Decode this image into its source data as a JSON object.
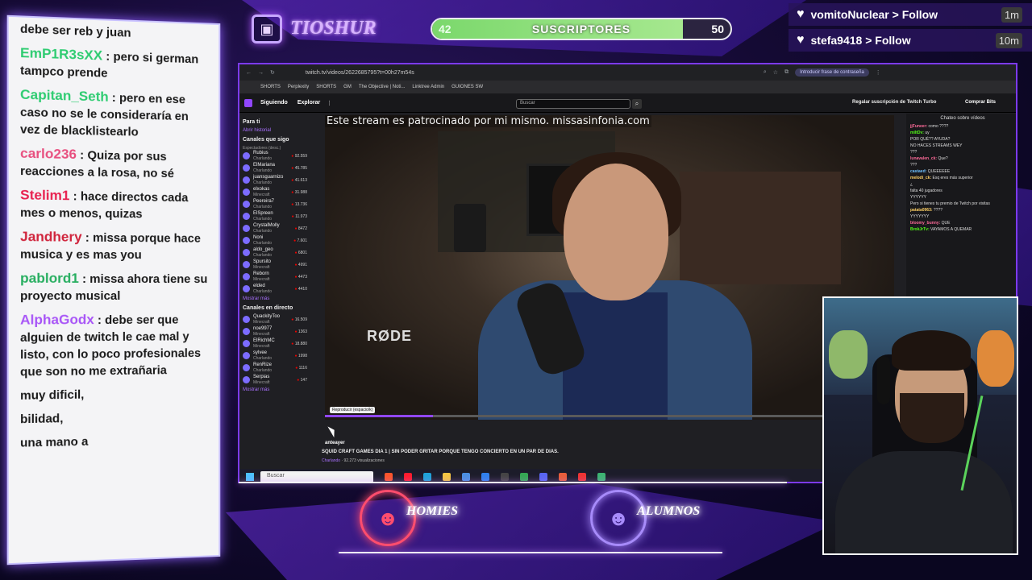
{
  "overlay": {
    "logo_text": "TIOSHUR",
    "subs": {
      "title": "SUSCRIPTORES",
      "current": "42",
      "goal": "50",
      "progress_fraction": 0.84
    },
    "follows": [
      {
        "user": "vomitoNuclear",
        "action": "Follow",
        "time": "1m"
      },
      {
        "user": "stefa9418",
        "action": "Follow",
        "time": "10m"
      }
    ],
    "chat": [
      {
        "user": "",
        "color": "#1a1a1a",
        "text": "debe ser reb y juan"
      },
      {
        "user": "EmP1R3sXX",
        "color": "#2ecc71",
        "text": "pero si german tampco prende"
      },
      {
        "user": "Capitan_Seth",
        "color": "#2ecc71",
        "text": "pero en ese caso no se le consideraría en vez de blacklistearlo"
      },
      {
        "user": "carlo236",
        "color": "#e84f7f",
        "text": "Quiza por sus reacciones a la rosa, no sé"
      },
      {
        "user": "Stelim1",
        "color": "#e8204f",
        "text": "hace directos cada mes o menos, quizas"
      },
      {
        "user": "Jandhery",
        "color": "#d0243c",
        "text": "missa porque hace musica y es mas you"
      },
      {
        "user": "pablord1",
        "color": "#27ae60",
        "text": "missa ahora tiene su proyecto musical"
      },
      {
        "user": "AlphaGodx",
        "color": "#a855f7",
        "text": "debe ser que alguien de twitch le cae mal y listo, con lo poco profesionales que son no me extrañaria"
      },
      {
        "user": "",
        "color": "#1a1a1a",
        "text": "muy dificil,"
      },
      {
        "user": "",
        "color": "#1a1a1a",
        "text": "bilidad,"
      },
      {
        "user": "",
        "color": "#1a1a1a",
        "text": "una mano a"
      }
    ],
    "bottom_logos": [
      "HOMIES",
      "ALUMNOS"
    ]
  },
  "browser": {
    "url": "twitch.tv/videos/2622685795?t=00h27m54s",
    "password_prompt": "Introducir frase de contraseña",
    "bookmarks": [
      "SHORTS",
      "Perplexity",
      "SHORTS",
      "GM",
      "The Objective | Noti...",
      "Linktree Admin",
      "GUIONES SW"
    ],
    "twitch": {
      "following": "Siguiendo",
      "explore": "Explorar",
      "search_placeholder": "Buscar",
      "gift": "Regalar suscripción de Twitch Turbo",
      "bits": "Comprar Bits",
      "for_you": "Para ti",
      "history": "Abrir historial",
      "followed_heading": "Canales que sigo",
      "followed_sub": "Espectadores (desc.)",
      "followed": [
        {
          "name": "Rubius",
          "category": "Charlando",
          "viewers": "92.559"
        },
        {
          "name": "ElMariana",
          "category": "Charlando",
          "viewers": "45.785"
        },
        {
          "name": "juansguarnizo",
          "category": "Charlando",
          "viewers": "41.613"
        },
        {
          "name": "elxokas",
          "category": "Minecraft",
          "viewers": "31.988"
        },
        {
          "name": "Peereira7",
          "category": "Charlando",
          "viewers": "13.736"
        },
        {
          "name": "ElSpreen",
          "category": "Charlando",
          "viewers": "11.973"
        },
        {
          "name": "CrystalMolly",
          "category": "Charlando",
          "viewers": "8472"
        },
        {
          "name": "Noni",
          "category": "Charlando",
          "viewers": "7.601"
        },
        {
          "name": "aldo_geo",
          "category": "Charlando",
          "viewers": "6801"
        },
        {
          "name": "Spursito",
          "category": "Minecraft",
          "viewers": "4991"
        },
        {
          "name": "Reborn",
          "category": "Minecraft",
          "viewers": "4473"
        },
        {
          "name": "elded",
          "category": "Charlando",
          "viewers": "4410"
        }
      ],
      "show_more": "Mostrar más",
      "live_heading": "Canales en directo",
      "live": [
        {
          "name": "QuackityToo",
          "category": "Minecraft",
          "viewers": "16.509"
        },
        {
          "name": "noe9977",
          "category": "Minecraft",
          "viewers": "1363"
        },
        {
          "name": "ElRichMC",
          "category": "Minecraft",
          "viewers": "18.880"
        },
        {
          "name": "sylvee",
          "category": "Charlando",
          "viewers": "1998"
        },
        {
          "name": "RenRize",
          "category": "Charlando",
          "viewers": "1116"
        },
        {
          "name": "Serpias",
          "category": "Minecraft",
          "viewers": "147"
        }
      ],
      "video_overlay": "Este stream es patrocinado por mi mismo.",
      "video_overlay_url": "missasinfonia.com",
      "watermark": "RØDE",
      "tooltip": "Reproducir (espacio/k)",
      "playback_fraction": 0.19,
      "streamer": "anteayer",
      "title": "SQUID CRAFT GAMES DIA 1 | SIN PODER GRITAR PORQUE TENGO CONCIERTO EN UN PAR DE DIAS.",
      "category": "Charlando",
      "views": "92.273 visualizaciones",
      "chat_title": "Chateo sobre vídeos",
      "chat_lines": [
        {
          "user": "jjFuneer:",
          "text": "como ????"
        },
        {
          "user": "miltDv:",
          "text": "uy"
        },
        {
          "user": "",
          "text": "POR QUÉ?? AYUDA?"
        },
        {
          "user": "",
          "text": "NO HACES STREAMS WEY"
        },
        {
          "user": "",
          "text": "???"
        },
        {
          "user": "lunavalen_ck:",
          "text": "Que?"
        },
        {
          "user": "",
          "text": "???"
        },
        {
          "user": "castaed:",
          "text": "QUEEEEEE"
        },
        {
          "user": "melodi_ck:",
          "text": "Esq eres más superior"
        },
        {
          "user": "",
          "text": "¿"
        },
        {
          "user": "",
          "text": "falta 40 jugadores"
        },
        {
          "user": "",
          "text": "YYYYYY"
        },
        {
          "user": "",
          "text": "Pero si tienes tu premio de Twitch por visitas"
        },
        {
          "user": "patata0963:",
          "text": "????"
        },
        {
          "user": "",
          "text": "YYYYYYY"
        },
        {
          "user": "bloomy_bunny:",
          "text": "QUE"
        },
        {
          "user": "BrokJrTv:",
          "text": "VAYAMOS A QUEMAR"
        }
      ]
    },
    "taskbar_search": "Buscar"
  }
}
